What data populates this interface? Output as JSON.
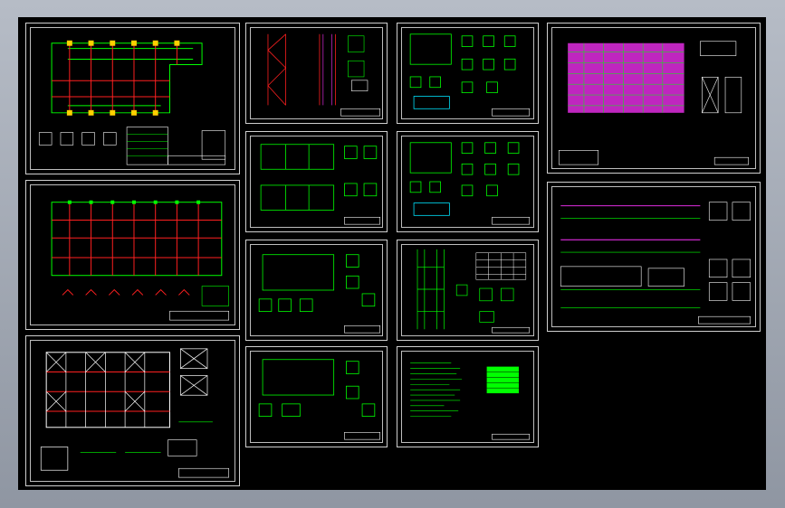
{
  "window": {
    "title": ""
  },
  "colors": {
    "background": "#000000",
    "frame": "#cfcfcf",
    "grid": "#00ff00",
    "red": "#ff2020",
    "magenta": "#ff33ff",
    "white": "#ffffff",
    "cyan": "#00e5ff"
  },
  "sheets": [
    {
      "id": "s1",
      "kind": "plan-red"
    },
    {
      "id": "s2",
      "kind": "plan-red"
    },
    {
      "id": "s3",
      "kind": "brace-plan"
    },
    {
      "id": "s4",
      "kind": "elevation"
    },
    {
      "id": "s5",
      "kind": "details"
    },
    {
      "id": "s6",
      "kind": "magenta-plan"
    },
    {
      "id": "s7",
      "kind": "rect-detail"
    },
    {
      "id": "s8",
      "kind": "details"
    },
    {
      "id": "s9",
      "kind": "long-elev"
    },
    {
      "id": "s10",
      "kind": "rect-detail"
    },
    {
      "id": "s11",
      "kind": "column-table"
    },
    {
      "id": "s12",
      "kind": "rect-detail"
    },
    {
      "id": "s13",
      "kind": "notes"
    }
  ]
}
